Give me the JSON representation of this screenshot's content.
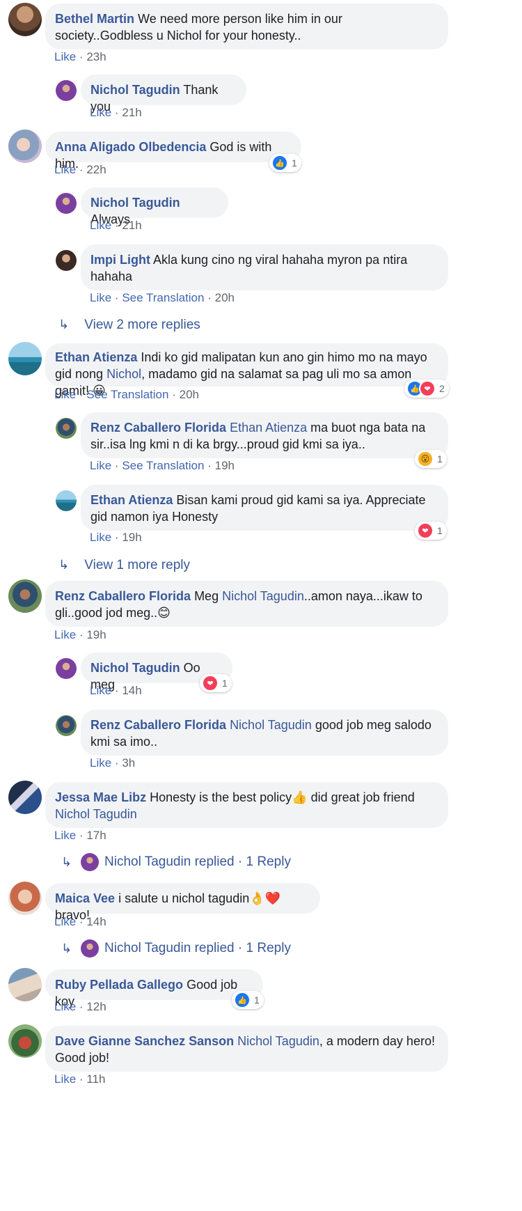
{
  "comments": [
    {
      "name": "Bethel Martin",
      "text": "We need more person like him in our society..Godbless u Nichol for your honesty..",
      "like": "Like",
      "time": "23h"
    },
    {
      "name": "Nichol Tagudin",
      "text": "Thank you",
      "like": "Like",
      "time": "21h"
    },
    {
      "name": "Anna Aligado Olbedencia",
      "text": "God is with him.",
      "like": "Like",
      "time": "22h",
      "reaction_count": "1"
    },
    {
      "name": "Nichol Tagudin",
      "text": "Always",
      "like": "Like",
      "time": "21h"
    },
    {
      "name": "Impi Light",
      "text": "Akla kung cino ng viral hahaha myron pa ntira hahaha",
      "like": "Like",
      "translate": "See Translation",
      "time": "20h"
    },
    {
      "name": "Ethan Atienza",
      "text_a": "Indi ko gid malipatan kun ano gin himo mo na mayo gid nong ",
      "mention": "Nichol",
      "text_b": ", madamo gid na salamat sa pag uli mo sa amon gamit! ",
      "emoji": "😀",
      "like": "Like",
      "translate": "See Translation",
      "time": "20h",
      "reaction_count": "2"
    },
    {
      "name": "Renz Caballero Florida",
      "mention": "Ethan Atienza",
      "text": " ma buot nga bata na sir..isa lng kmi n di ka brgy...proud gid kmi sa iya..",
      "like": "Like",
      "translate": "See Translation",
      "time": "19h",
      "reaction_count": "1"
    },
    {
      "name": "Ethan Atienza",
      "text": "Bisan kami proud gid kami sa iya. Appreciate gid namon iya Honesty",
      "like": "Like",
      "time": "19h",
      "reaction_count": "1"
    },
    {
      "name": "Renz Caballero Florida",
      "text_a": "Meg ",
      "mention": "Nichol Tagudin",
      "text_b": "..amon naya...ikaw to gli..good jod meg..",
      "emoji": "😊",
      "like": "Like",
      "time": "19h"
    },
    {
      "name": "Nichol Tagudin",
      "text": "Oo meg",
      "like": "Like",
      "time": "14h",
      "reaction_count": "1"
    },
    {
      "name": "Renz Caballero Florida",
      "mention": "Nichol Tagudin",
      "text": " good job meg salodo kmi sa imo..",
      "like": "Like",
      "time": "3h"
    },
    {
      "name": "Jessa Mae Libz",
      "text": "Honesty is the best policy",
      "emoji": "👍",
      "text_b": " did great job friend",
      "mention": "Nichol Tagudin",
      "like": "Like",
      "time": "17h"
    },
    {
      "name": "Maica Vee",
      "text": "i salute u nichol tagudin",
      "emoji": "👌",
      "emoji2": "❤️",
      "text_b": "bravo!",
      "like": "Like",
      "time": "14h"
    },
    {
      "name": "Ruby Pellada Gallego",
      "text": "Good job koy",
      "like": "Like",
      "time": "12h",
      "reaction_count": "1"
    },
    {
      "name": "Dave Gianne Sanchez Sanson",
      "mention": "Nichol Tagudin",
      "text": ", a modern day hero! Good job!",
      "like": "Like",
      "time": "11h"
    }
  ],
  "view_more": [
    "View 2 more replies",
    "View 1 more reply"
  ],
  "replied": [
    {
      "name": "Nichol Tagudin",
      "action": "replied",
      "sep": "·",
      "count": "1 Reply"
    },
    {
      "name": "Nichol Tagudin",
      "action": "replied",
      "sep": "·",
      "count": "1 Reply"
    }
  ],
  "sep": "·",
  "colors": {
    "name": "#385898",
    "bubble": "#f2f3f5",
    "meta_link": "#4267b2",
    "meta_time": "#606770",
    "like": "#1877f2",
    "love": "#f33e58"
  },
  "icons": {
    "reply_arrow": "↳",
    "like": "👍",
    "love": "❤",
    "wow": "😮"
  }
}
